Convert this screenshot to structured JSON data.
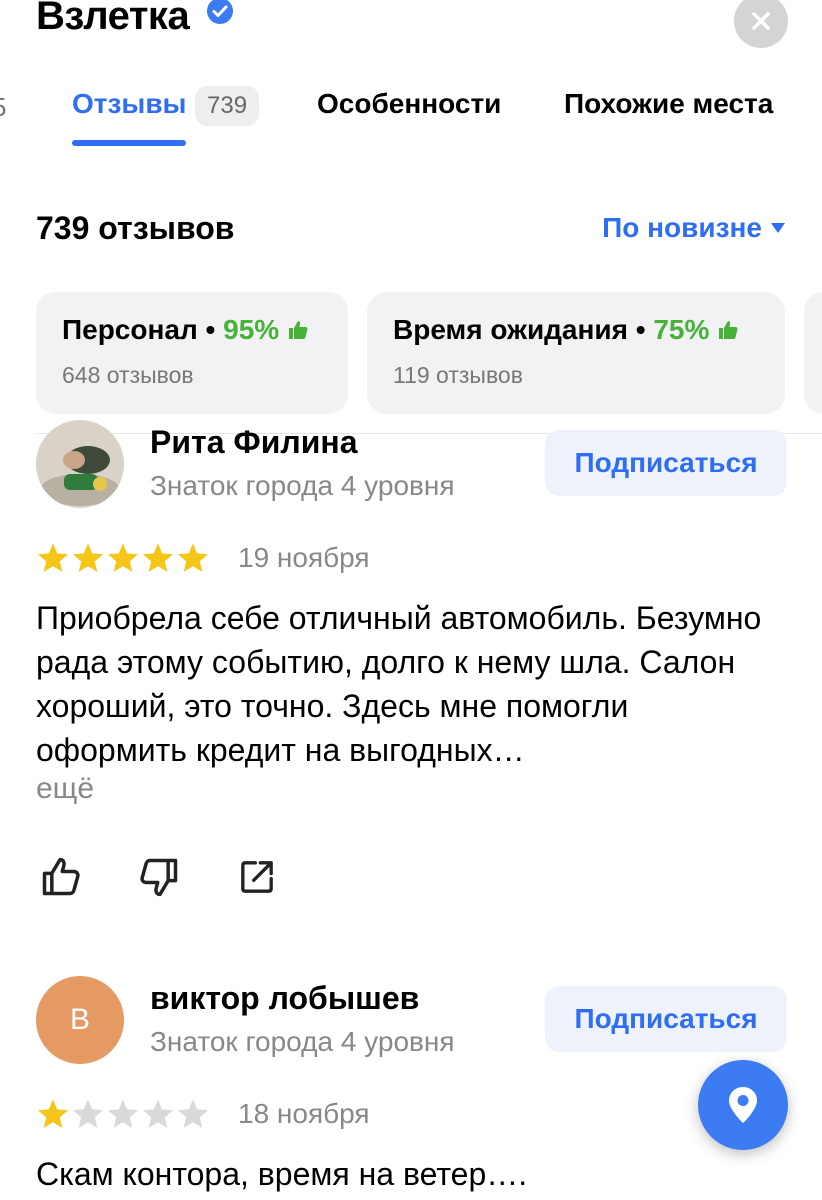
{
  "header": {
    "title": "Взлетка"
  },
  "tabs": {
    "cut_label": "5",
    "items": [
      {
        "label": "Отзывы",
        "count": "739",
        "active": true
      },
      {
        "label": "Особенности"
      },
      {
        "label": "Похожие места"
      }
    ]
  },
  "summary": {
    "count_label": "739 отзывов",
    "sort_label": "По новизне"
  },
  "aspects": [
    {
      "name": "Персонал",
      "percent": "95%",
      "reviews": "648 отзывов"
    },
    {
      "name": "Время ожидания",
      "percent": "75%",
      "reviews": "119 отзывов"
    }
  ],
  "reviews": [
    {
      "author": "Рита Филина",
      "level": "Знаток города 4 уровня",
      "subscribe_label": "Подписаться",
      "rating": 5,
      "date": "19 ноября",
      "text": "Приобрела себе отличный автомобиль. Безумно рада этому событию, долго к нему шла. Салон хороший, это точно. Здесь мне помогли оформить кредит на выгодных…",
      "more_label": "ещё"
    },
    {
      "author": "виктор лобышев",
      "avatar_letter": "В",
      "level": "Знаток города 4 уровня",
      "subscribe_label": "Подписаться",
      "rating": 1,
      "date": "18 ноября",
      "text": "Скам контора, время на ветер…."
    }
  ],
  "colors": {
    "accent": "#2f6ef2",
    "positive": "#48b139",
    "star_filled": "#f5c518",
    "star_empty": "#d9d9d9",
    "avatar_orange": "#e59a64"
  }
}
